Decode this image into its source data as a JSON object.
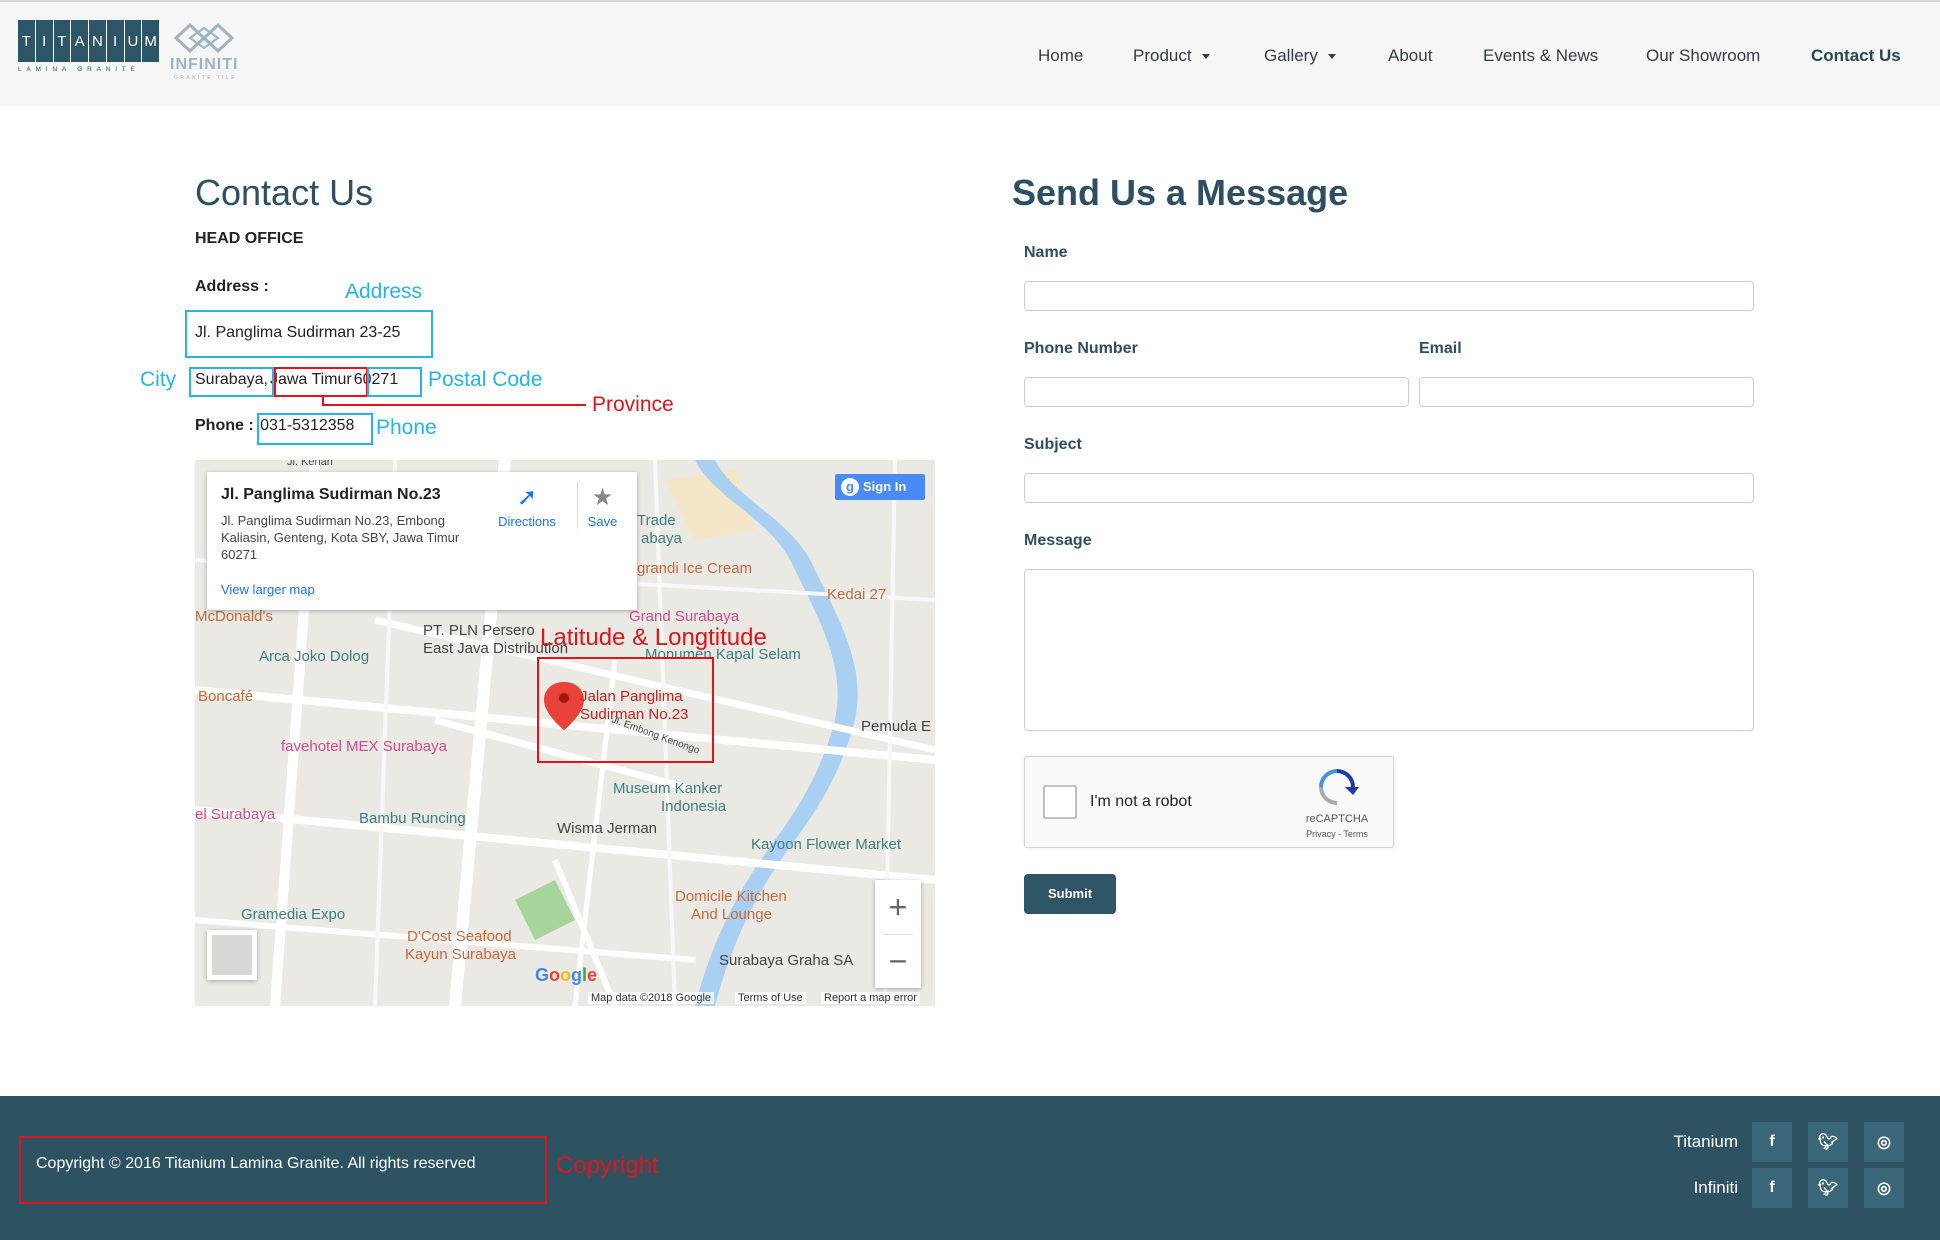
{
  "brand": {
    "titanium_letters": [
      "T",
      "I",
      "T",
      "A",
      "N",
      "I",
      "U",
      "M"
    ],
    "titanium_sub": "LAMINA GRANITE",
    "infiniti_word": "INFINITI",
    "infiniti_tag": "GRANITE TILE"
  },
  "nav": {
    "home": "Home",
    "product": "Product",
    "gallery": "Gallery",
    "about": "About",
    "events": "Events & News",
    "showroom": "Our Showroom",
    "contact": "Contact Us"
  },
  "contact": {
    "title": "Contact Us",
    "head_office": "HEAD OFFICE",
    "address_label": "Address :",
    "address_line1": "Jl. Panglima Sudirman 23-25",
    "city": "Surabaya,",
    "province": "Jawa Timur",
    "postal_code": "60271",
    "phone_label": "Phone :",
    "phone": "031-5312358"
  },
  "annotations": {
    "address": "Address",
    "city": "City",
    "postal_code": "Postal Code",
    "province": "Province",
    "phone": "Phone",
    "latlng": "Latitude & Longtitude",
    "copyright": "Copyright"
  },
  "map": {
    "card_title": "Jl. Panglima Sudirman No.23",
    "card_address": "Jl. Panglima Sudirman No.23, Embong Kaliasin, Genteng, Kota SBY, Jawa Timur 60271",
    "directions": "Directions",
    "save": "Save",
    "view_larger": "View larger map",
    "sign_in": "Sign In",
    "pin_label_1": "Jalan Panglima",
    "pin_label_2": "Sudirman No.23",
    "map_data": "Map data ©2018 Google",
    "terms": "Terms of Use",
    "report": "Report a map error",
    "labels": {
      "kenari": "Jl. Kenari",
      "trade": "Trade",
      "abaya": "abaya",
      "zangrandi": "grandi Ice Cream",
      "kedai": "Kedai 27",
      "grand": "Grand Surabaya",
      "mcd": "McDonald's",
      "pln1": "PT. PLN Persero",
      "pln2": "East Java Distribution",
      "monumen": "Monumen Kapal Selam",
      "arca": "Arca Joko Dolog",
      "boncafe": "Boncafé",
      "pemuda": "Pemuda E",
      "fave": "favehotel MEX Surabaya",
      "museum1": "Museum Kanker",
      "museum2": "Indonesia",
      "surabaya": "el Surabaya",
      "bambu": "Bambu Runcing",
      "wisma": "Wisma Jerman",
      "kayoon": "Kayoon Flower Market",
      "domicile1": "Domicile Kitchen",
      "domicile2": "And Lounge",
      "gramedia": "Gramedia Expo",
      "dcost1": "D'Cost Seafood",
      "dcost2": "Kayun Surabaya",
      "graha": "Surabaya Graha SA",
      "embong": "Jl. Embong Kenongo"
    }
  },
  "form": {
    "title": "Send Us a Message",
    "name_label": "Name",
    "phone_label": "Phone Number",
    "email_label": "Email",
    "subject_label": "Subject",
    "message_label": "Message",
    "captcha_label": "I'm not a robot",
    "captcha_brand": "reCAPTCHA",
    "captcha_links": "Privacy - Terms",
    "submit": "Submit"
  },
  "footer": {
    "copyright": "Copyright © 2016 Titanium Lamina Granite. All rights reserved",
    "brand_titanium": "Titanium",
    "brand_infiniti": "Infiniti",
    "icons": [
      "facebook-icon",
      "twitter-icon",
      "instagram-icon"
    ]
  },
  "colors": {
    "primary": "#2d5363",
    "annotation_blue": "#27b3ea",
    "annotation_red": "#e1141b",
    "heading": "#2e4f63"
  }
}
